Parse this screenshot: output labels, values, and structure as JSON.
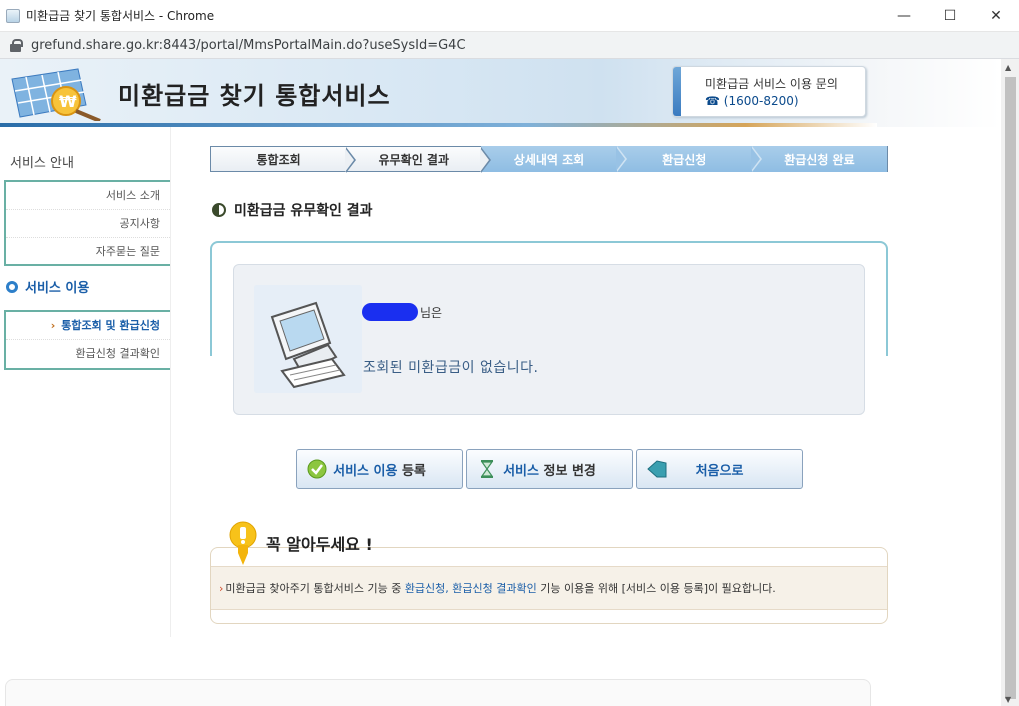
{
  "browser": {
    "window_title": "미환급금 찾기 통합서비스 - Chrome",
    "url": "grefund.share.go.kr:8443/portal/MmsPortalMain.do?useSysId=G4C",
    "minimize": "—",
    "maximize": "☐",
    "close": "✕"
  },
  "header": {
    "title": "미환급금 찾기 통합서비스",
    "contact_label": "미환급금 서비스 이용 문의",
    "contact_phone": "☎ (1600-8200)"
  },
  "sidebar": {
    "section1_title": "서비스 안내",
    "section1_items": [
      "서비스 소개",
      "공지사항",
      "자주묻는 질문"
    ],
    "section2_title": "서비스 이용",
    "section2_items": [
      {
        "label": "통합조회 및 환급신청",
        "active": true
      },
      {
        "label": "환급신청 결과확인",
        "active": false
      }
    ]
  },
  "steps": [
    {
      "label": "통합조회",
      "state": "done"
    },
    {
      "label": "유무확인 결과",
      "state": "done"
    },
    {
      "label": "상세내역 조회",
      "state": "todo"
    },
    {
      "label": "환급신청",
      "state": "todo"
    },
    {
      "label": "환급신청 완료",
      "state": "todo"
    }
  ],
  "result": {
    "heading": "미환급금 유무확인 결과",
    "user_suffix": "님은",
    "message": "조회된 미환급금이 없습니다."
  },
  "buttons": {
    "register_hl": "서비스 이용",
    "register_rest": " 등록",
    "change_hl": "서비스",
    "change_rest": " 정보 변경",
    "home": "처음으로"
  },
  "notice": {
    "title": "꼭 알아두세요 !",
    "arrow": "›",
    "text_before": "미환급금 찾아주기 통합서비스 기능 중 ",
    "text_link": "환급신청, 환급신청 결과확인",
    "text_after": " 기능 이용을 위해 [서비스 이용 등록]이 필요합니다."
  }
}
